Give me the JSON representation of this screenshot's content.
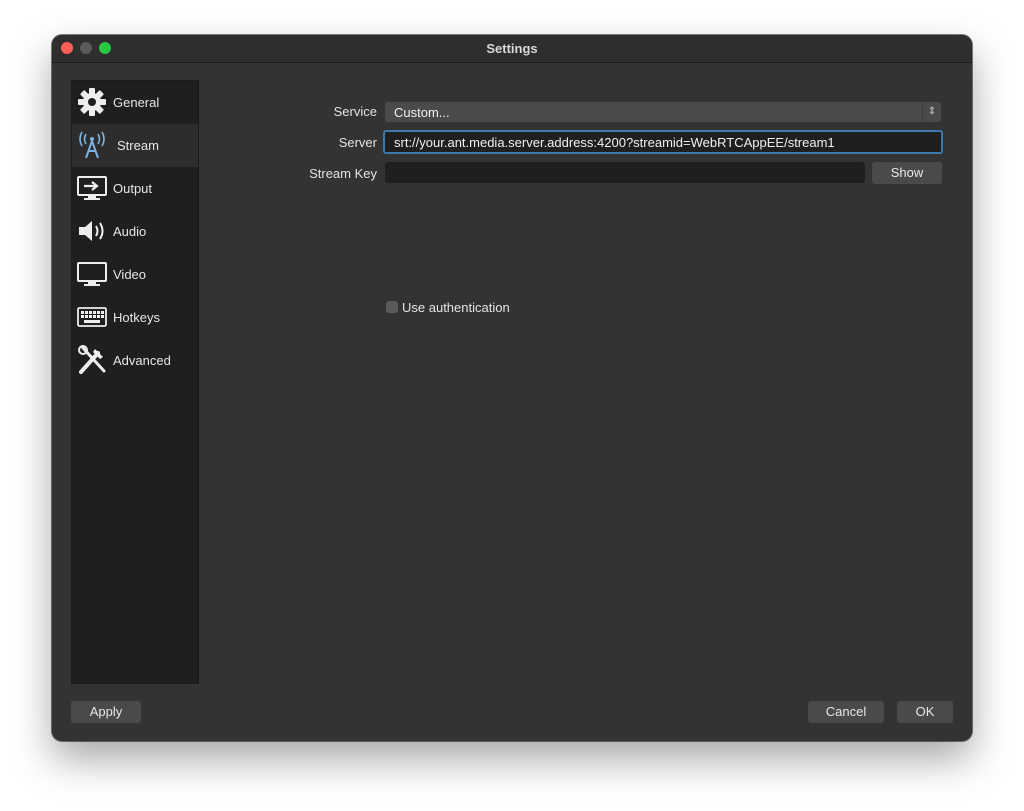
{
  "window": {
    "title": "Settings"
  },
  "sidebar": {
    "items": [
      {
        "label": "General",
        "icon": "gear-icon"
      },
      {
        "label": "Stream",
        "icon": "antenna-icon"
      },
      {
        "label": "Output",
        "icon": "output-icon"
      },
      {
        "label": "Audio",
        "icon": "speaker-icon"
      },
      {
        "label": "Video",
        "icon": "monitor-icon"
      },
      {
        "label": "Hotkeys",
        "icon": "keyboard-icon"
      },
      {
        "label": "Advanced",
        "icon": "tools-icon"
      }
    ],
    "active": "Stream"
  },
  "stream": {
    "service_label": "Service",
    "service_value": "Custom...",
    "server_label": "Server",
    "server_value": "srt://your.ant.media.server.address:4200?streamid=WebRTCAppEE/stream1",
    "stream_key_label": "Stream Key",
    "stream_key_value": "",
    "show_button": "Show",
    "use_auth_label": "Use authentication",
    "use_auth_checked": false
  },
  "footer": {
    "apply": "Apply",
    "cancel": "Cancel",
    "ok": "OK"
  },
  "colors": {
    "accent": "#3d78a8",
    "window_bg": "#333333",
    "sidebar_bg": "#1f1f1f"
  }
}
